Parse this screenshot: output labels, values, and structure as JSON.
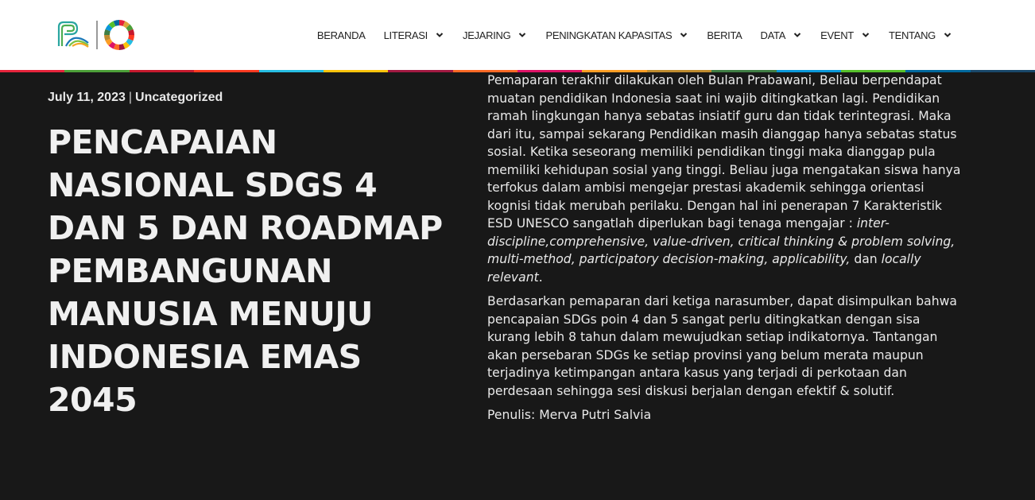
{
  "header": {
    "logo_alt": "logo",
    "nav": [
      {
        "label": "BERANDA",
        "dropdown": false
      },
      {
        "label": "LITERASI",
        "dropdown": true
      },
      {
        "label": "JEJARING",
        "dropdown": true
      },
      {
        "label": "PENINGKATAN KAPASITAS",
        "dropdown": true
      },
      {
        "label": "BERITA",
        "dropdown": false
      },
      {
        "label": "DATA",
        "dropdown": true
      },
      {
        "label": "EVENT",
        "dropdown": true
      },
      {
        "label": "TENTANG",
        "dropdown": true
      }
    ],
    "stripe_colors": [
      "#e5243b",
      "#4c9f38",
      "#c5192d",
      "#ff3a21",
      "#26bde2",
      "#fcc30b",
      "#a21942",
      "#fd6925",
      "#dd1367",
      "#fd9d24",
      "#bf8b2e",
      "#3f7e44",
      "#0a97d9",
      "#56c02b",
      "#00689d",
      "#19486a"
    ]
  },
  "article": {
    "date": "July 11, 2023",
    "separator": "|",
    "category": "Uncategorized",
    "title": "PENCAPAIAN NASIONAL SDGS 4 DAN 5 DAN ROADMAP PEMBANGUNAN MANUSIA  MENUJU INDONESIA EMAS 2045",
    "p1_text": "Pemaparan terakhir dilakukan oleh Bulan Prabawani, Beliau berpendapat muatan pendidikan Indonesia saat ini wajib ditingkatkan lagi. Pendidikan ramah lingkungan hanya sebatas insiatif guru dan tidak terintegrasi. Maka dari itu, sampai sekarang Pendidikan masih dianggap hanya sebatas status sosial. Ketika seseorang memiliki pendidikan tinggi maka dianggap pula memiliki kehidupan sosial yang tinggi. Beliau juga mengatakan siswa hanya terfokus dalam ambisi mengejar prestasi akademik sehingga orientasi kognisi tidak merubah perilaku. Dengan hal ini penerapan 7 Karakteristik ESD UNESCO sangatlah diperlukan bagi tenaga mengajar : ",
    "p1_italic": "inter-discipline,comprehensive, value-driven, critical thinking & problem solving, multi-method, participatory decision-making, applicability,",
    "p1_and": " dan ",
    "p1_italic2": "locally relevant",
    "p1_end": ".",
    "p2": "Berdasarkan pemaparan dari ketiga narasumber, dapat disimpulkan bahwa pencapaian SDGs poin 4 dan 5 sangat perlu ditingkatkan dengan sisa kurang lebih 8 tahun dalam mewujudkan setiap indikatornya. Tantangan akan persebaran SDGs ke setiap provinsi yang belum merata maupun terjadinya ketimpangan antara kasus yang terjadi di perkotaan dan perdesaan sehingga sesi diskusi berjalan dengan efektif & solutif.",
    "author": "Penulis: Merva Putri Salvia"
  }
}
